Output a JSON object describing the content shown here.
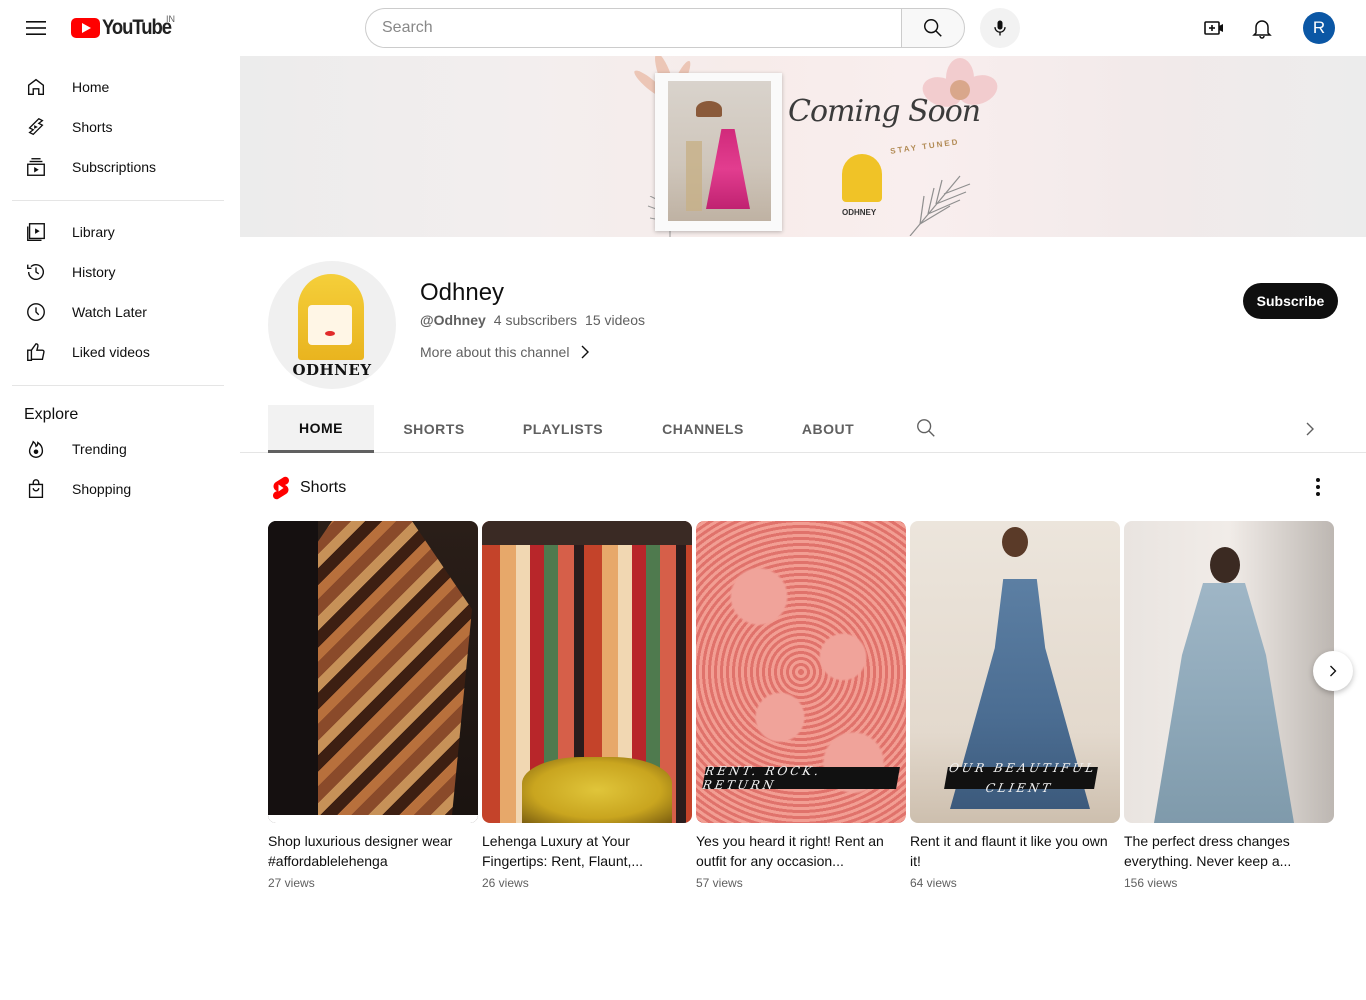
{
  "header": {
    "logo_text": "YouTube",
    "country_code": "IN",
    "search_placeholder": "Search",
    "avatar_letter": "R"
  },
  "sidebar": {
    "main": [
      {
        "label": "Home",
        "icon": "home-icon"
      },
      {
        "label": "Shorts",
        "icon": "shorts-icon"
      },
      {
        "label": "Subscriptions",
        "icon": "subscriptions-icon"
      }
    ],
    "library": [
      {
        "label": "Library",
        "icon": "library-icon"
      },
      {
        "label": "History",
        "icon": "history-icon"
      },
      {
        "label": "Watch Later",
        "icon": "watch-later-icon"
      },
      {
        "label": "Liked videos",
        "icon": "liked-icon"
      }
    ],
    "explore_title": "Explore",
    "explore": [
      {
        "label": "Trending",
        "icon": "trending-icon"
      },
      {
        "label": "Shopping",
        "icon": "shopping-icon"
      }
    ]
  },
  "banner": {
    "headline": "Coming Soon",
    "tagline": "STAY TUNED",
    "brand": "ODHNEY"
  },
  "channel": {
    "avatar_text": "ODHNEY",
    "name": "Odhney",
    "handle": "@Odhney",
    "subscribers": "4 subscribers",
    "videos": "15 videos",
    "more_about": "More about this channel",
    "subscribe_label": "Subscribe"
  },
  "tabs": [
    "HOME",
    "SHORTS",
    "PLAYLISTS",
    "CHANNELS",
    "ABOUT"
  ],
  "shelf": {
    "title": "Shorts",
    "shorts": [
      {
        "title": "Shop luxurious designer wear #affordablelehenga",
        "views": "27 views",
        "overlay": ""
      },
      {
        "title": "Lehenga Luxury at Your Fingertips: Rent, Flaunt,...",
        "views": "26 views",
        "overlay": ""
      },
      {
        "title": "Yes you heard it right! Rent an outfit for any occasion...",
        "views": "57 views",
        "overlay": "RENT. ROCK. RETURN"
      },
      {
        "title": "Rent it and flaunt it like you own it!",
        "views": "64 views",
        "overlay": "OUR BEAUTIFUL CLIENT"
      },
      {
        "title": "The perfect dress changes everything. Never keep a...",
        "views": "156 views",
        "overlay": ""
      }
    ]
  },
  "colors": {
    "brand_red": "#ff0000",
    "avatar_bg": "#0b57a5",
    "subscribe_bg": "#0f0f0f",
    "text_primary": "#0f0f0f",
    "text_secondary": "#606060"
  }
}
